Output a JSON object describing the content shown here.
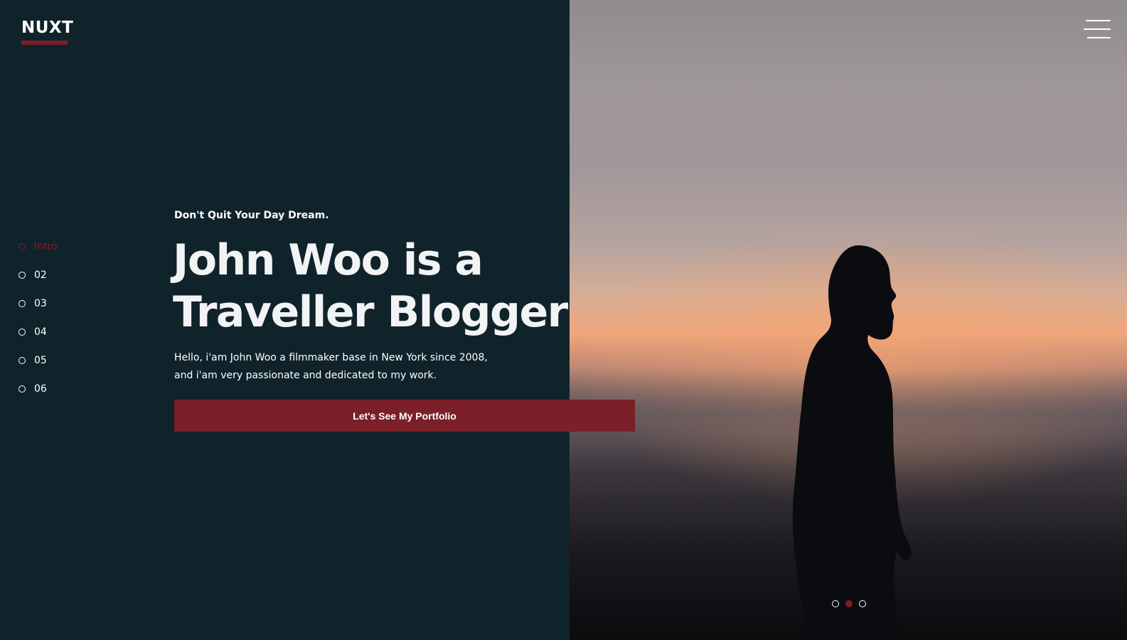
{
  "brand": {
    "logo_text": "NUXT",
    "accent_color": "#7b1f28",
    "background_color": "#10232b"
  },
  "header": {
    "menu_icon": "hamburger-icon"
  },
  "side_nav": {
    "items": [
      {
        "label": "Intro",
        "active": true
      },
      {
        "label": "02",
        "active": false
      },
      {
        "label": "03",
        "active": false
      },
      {
        "label": "04",
        "active": false
      },
      {
        "label": "05",
        "active": false
      },
      {
        "label": "06",
        "active": false
      }
    ]
  },
  "hero": {
    "tagline": "Don't Quit Your Day Dream.",
    "headline_line1": "John Woo is a",
    "headline_line2": "Traveller Blogger",
    "intro_line1": "Hello, i'am John Woo a filmmaker base in New York since 2008,",
    "intro_line2": "and i'am very passionate and dedicated to my work.",
    "cta_label": "Let's See My Portfolio"
  },
  "slider": {
    "slide_count": 3,
    "active_index": 1
  }
}
